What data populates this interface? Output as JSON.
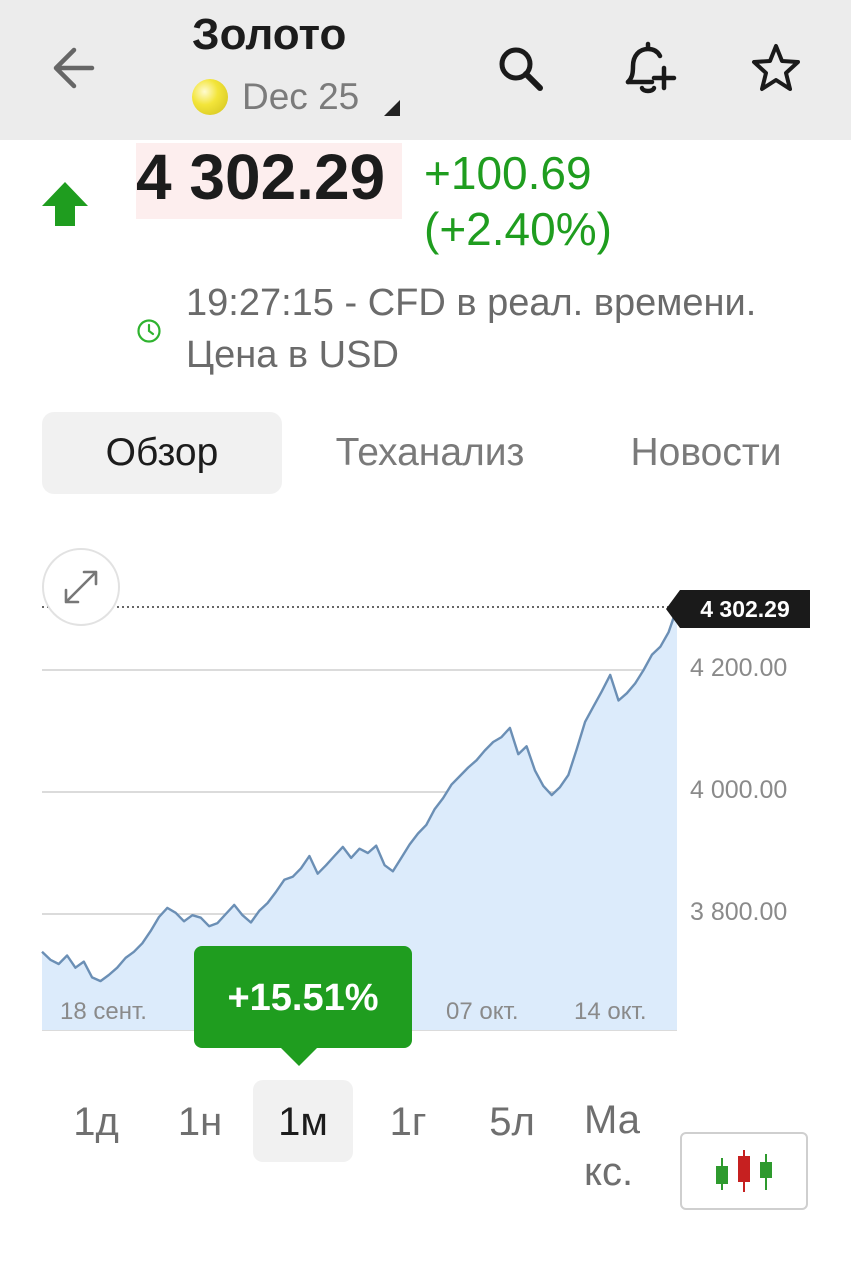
{
  "header": {
    "title": "Золото",
    "contract": "Dec 25",
    "icons": {
      "back": "arrow-left-icon",
      "search": "search-icon",
      "alert": "bell-plus-icon",
      "favorite": "star-icon",
      "contract_caret": "caret-down-icon"
    }
  },
  "quote": {
    "price": "4 302.29",
    "change": "+100.69",
    "change_percent": "(+2.40%)",
    "direction": "up",
    "status_line1": "19:27:15 - CFD в реал. времени.",
    "status_line2": "Цена в USD"
  },
  "tabs": [
    {
      "label": "Обзор",
      "active": true
    },
    {
      "label": "Теханализ",
      "active": false
    },
    {
      "label": "Новости",
      "active": false
    }
  ],
  "chart_data": {
    "type": "area",
    "y_ticks": [
      "4 200.00",
      "4 000.00",
      "3 800.00"
    ],
    "x_ticks": [
      "18 сент.",
      "07 окт.",
      "14 окт."
    ],
    "last_value_label": "4 302.29",
    "period_change": "+15.51%",
    "ylim": [
      3630,
      4370
    ],
    "grid": true,
    "values": [
      3738,
      3725,
      3718,
      3732,
      3712,
      3722,
      3696,
      3690,
      3700,
      3712,
      3728,
      3738,
      3752,
      3772,
      3795,
      3810,
      3802,
      3788,
      3798,
      3794,
      3780,
      3785,
      3800,
      3815,
      3798,
      3786,
      3805,
      3818,
      3836,
      3856,
      3861,
      3875,
      3895,
      3866,
      3880,
      3895,
      3910,
      3892,
      3907,
      3900,
      3912,
      3880,
      3870,
      3892,
      3914,
      3932,
      3946,
      3972,
      3990,
      4012,
      4026,
      4040,
      4052,
      4068,
      4082,
      4090,
      4105,
      4062,
      4075,
      4035,
      4010,
      3995,
      4008,
      4028,
      4070,
      4115,
      4140,
      4165,
      4192,
      4150,
      4162,
      4178,
      4200,
      4225,
      4238,
      4262,
      4302
    ]
  },
  "ranges": [
    "1д",
    "1н",
    "1м",
    "1г",
    "5л",
    "Макс."
  ],
  "active_range": "1м",
  "colors": {
    "up": "#1f9d1f",
    "line": "#6b8fb5",
    "area": "#dcebfb",
    "price_bg": "#fdeeee"
  }
}
